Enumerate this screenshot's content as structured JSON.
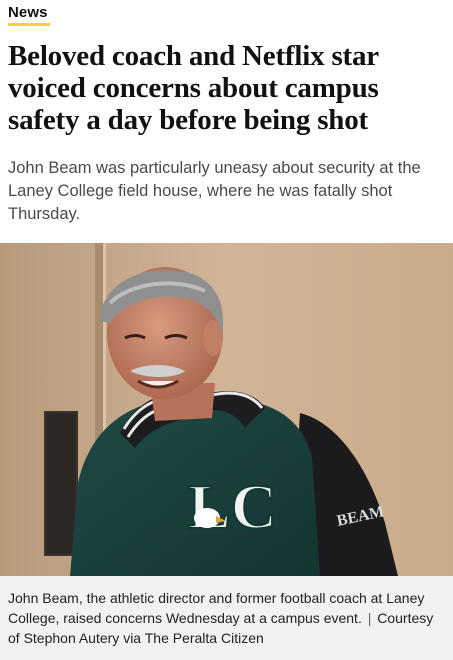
{
  "section": {
    "label": "News",
    "accent_color": "#f2d33a"
  },
  "article": {
    "headline": "Beloved coach and Netflix star voiced concerns about campus safety a day before being shot",
    "dek": "John Beam was particularly uneasy about security at the Laney College field house, where he was fatally shot Thursday."
  },
  "photo": {
    "jacket_letters": "LC",
    "sleeve_text": "BEAM"
  },
  "caption": {
    "text": "John Beam, the athletic director and former football coach at Laney College, raised concerns Wednesday at a campus event.",
    "separator": "|",
    "credit": "Courtesy of Stephon Autery via The Peralta Citizen"
  }
}
